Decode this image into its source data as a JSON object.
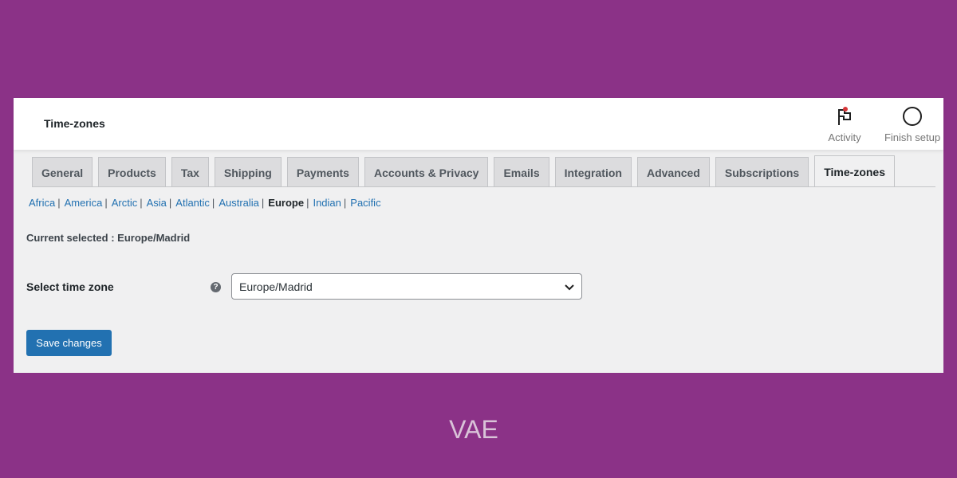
{
  "header": {
    "title": "Time-zones",
    "activity_label": "Activity",
    "finish_setup_label": "Finish setup",
    "activity_icon": "flag-icon",
    "finish_setup_icon": "circle-progress-icon",
    "notification_dot_color": "#d63638"
  },
  "tabs": [
    {
      "label": "General",
      "active": false
    },
    {
      "label": "Products",
      "active": false
    },
    {
      "label": "Tax",
      "active": false
    },
    {
      "label": "Shipping",
      "active": false
    },
    {
      "label": "Payments",
      "active": false
    },
    {
      "label": "Accounts & Privacy",
      "active": false
    },
    {
      "label": "Emails",
      "active": false
    },
    {
      "label": "Integration",
      "active": false
    },
    {
      "label": "Advanced",
      "active": false
    },
    {
      "label": "Subscriptions",
      "active": false
    },
    {
      "label": "Time-zones",
      "active": true
    }
  ],
  "regions": [
    {
      "label": "Africa",
      "current": false
    },
    {
      "label": "America",
      "current": false
    },
    {
      "label": "Arctic",
      "current": false
    },
    {
      "label": "Asia",
      "current": false
    },
    {
      "label": "Atlantic",
      "current": false
    },
    {
      "label": "Australia",
      "current": false
    },
    {
      "label": "Europe",
      "current": true
    },
    {
      "label": "Indian",
      "current": false
    },
    {
      "label": "Pacific",
      "current": false
    }
  ],
  "region_separator": "|",
  "current_selected": {
    "label": "Current selected :",
    "value": "Europe/Madrid"
  },
  "timezone_field": {
    "label": "Select time zone",
    "help_icon": "question-circle-icon",
    "help_glyph": "?",
    "value": "Europe/Madrid"
  },
  "save_button": {
    "label": "Save changes"
  },
  "footer_text": "VAE",
  "colors": {
    "background": "#8b3287",
    "accent": "#2271b1",
    "panel": "#f0f0f1"
  }
}
